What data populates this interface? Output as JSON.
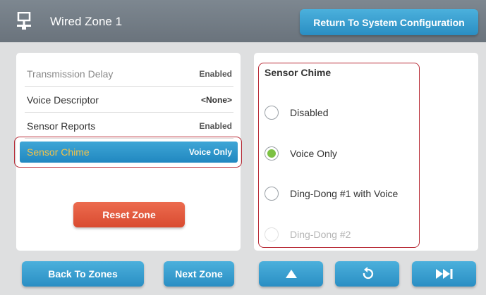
{
  "header": {
    "icon": "wired-network-icon",
    "title": "Wired Zone 1",
    "return_label": "Return To System Configuration"
  },
  "settings": {
    "rows": [
      {
        "label": "Transmission Delay",
        "value": "Enabled"
      },
      {
        "label": "Voice Descriptor",
        "value": "<None>"
      },
      {
        "label": "Sensor Reports",
        "value": "Enabled"
      },
      {
        "label": "Sensor Chime",
        "value": "Voice Only",
        "selected": true
      }
    ],
    "reset_label": "Reset Zone"
  },
  "chime": {
    "title": "Sensor Chime",
    "options": [
      {
        "label": "Disabled",
        "selected": false
      },
      {
        "label": "Voice Only",
        "selected": true
      },
      {
        "label": "Ding-Dong #1 with Voice",
        "selected": false
      },
      {
        "label": "Ding-Dong #2",
        "selected": false
      }
    ]
  },
  "footer": {
    "back_label": "Back To Zones",
    "next_label": "Next Zone",
    "up_icon": "up-arrow-icon",
    "undo_icon": "undo-icon",
    "fast_forward_icon": "fast-forward-icon"
  },
  "colors": {
    "header": "#6f7982",
    "button_blue": "#2a8ec3",
    "reset_red": "#d94b30",
    "selected_text": "#f2c24a",
    "radio_selected": "#7cc143",
    "highlight_outline": "#b82a35"
  }
}
